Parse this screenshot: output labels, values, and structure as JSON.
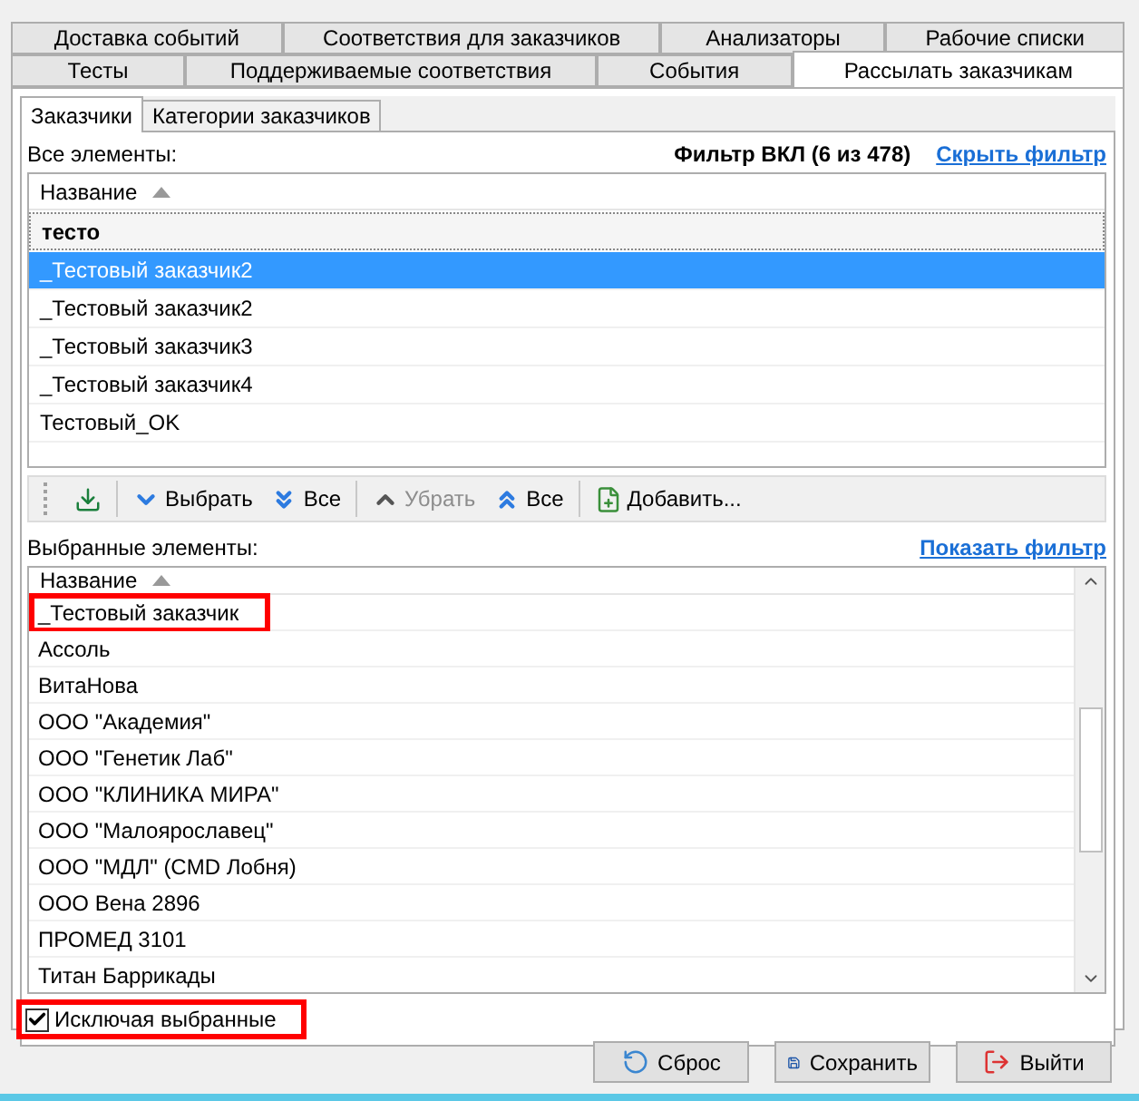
{
  "tabs_row1": [
    {
      "label": "Доставка событий",
      "selected": false
    },
    {
      "label": "Соответствия для заказчиков",
      "selected": false
    },
    {
      "label": "Анализаторы",
      "selected": false
    },
    {
      "label": "Рабочие списки",
      "selected": false
    }
  ],
  "tabs_row2": [
    {
      "label": "Тесты",
      "selected": false
    },
    {
      "label": "Поддерживаемые соответствия",
      "selected": false
    },
    {
      "label": "События",
      "selected": false
    },
    {
      "label": "Рассылать заказчикам",
      "selected": true
    }
  ],
  "subtabs": [
    {
      "label": "Заказчики",
      "selected": true
    },
    {
      "label": "Категории заказчиков",
      "selected": false
    }
  ],
  "all_items": {
    "label": "Все элементы:",
    "filter_status": "Фильтр ВКЛ (6 из 478)",
    "filter_link": "Скрыть фильтр",
    "column": "Название",
    "filter_value": "тесто",
    "rows": [
      {
        "name": "_Тестовый заказчик2",
        "selected": true
      },
      {
        "name": "_Тестовый заказчик2",
        "selected": false
      },
      {
        "name": "_Тестовый заказчик3",
        "selected": false
      },
      {
        "name": "_Тестовый заказчик4",
        "selected": false
      },
      {
        "name": "Тестовый_OK",
        "selected": false
      }
    ]
  },
  "toolbar": [
    {
      "kind": "import"
    },
    {
      "kind": "down",
      "label": "Выбрать",
      "disabled": false
    },
    {
      "kind": "all_down",
      "label": "Все",
      "disabled": false
    },
    {
      "kind": "up",
      "label": "Убрать",
      "disabled": true
    },
    {
      "kind": "all_up",
      "label": "Все",
      "disabled": false
    },
    {
      "kind": "add",
      "label": "Добавить...",
      "disabled": false
    }
  ],
  "selected_items": {
    "label": "Выбранные элементы:",
    "filter_link": "Показать фильтр",
    "column": "Название",
    "rows": [
      {
        "name": "_Тестовый заказчик",
        "highlighted": true
      },
      {
        "name": "Ассоль",
        "highlighted": false
      },
      {
        "name": "ВитаНова",
        "highlighted": false
      },
      {
        "name": "ООО \"Академия\"",
        "highlighted": false
      },
      {
        "name": "ООО \"Генетик Лаб\"",
        "highlighted": false
      },
      {
        "name": "ООО \"КЛИНИКА МИРА\"",
        "highlighted": false
      },
      {
        "name": "ООО \"Малоярославец\"",
        "highlighted": false
      },
      {
        "name": "ООО \"МДЛ\" (CMD Лобня)",
        "highlighted": false
      },
      {
        "name": "ООО Вена 2896",
        "highlighted": false
      },
      {
        "name": "ПРОМЕД 3101",
        "highlighted": false
      },
      {
        "name": "Титан Баррикады",
        "highlighted": false
      }
    ]
  },
  "exclude_checkbox": {
    "label": "Исключая выбранные",
    "checked": true,
    "highlighted": true
  },
  "buttons": [
    {
      "kind": "reset",
      "label": "Сброс"
    },
    {
      "kind": "save",
      "label": "Сохранить"
    },
    {
      "kind": "exit",
      "label": "Выйти"
    }
  ]
}
